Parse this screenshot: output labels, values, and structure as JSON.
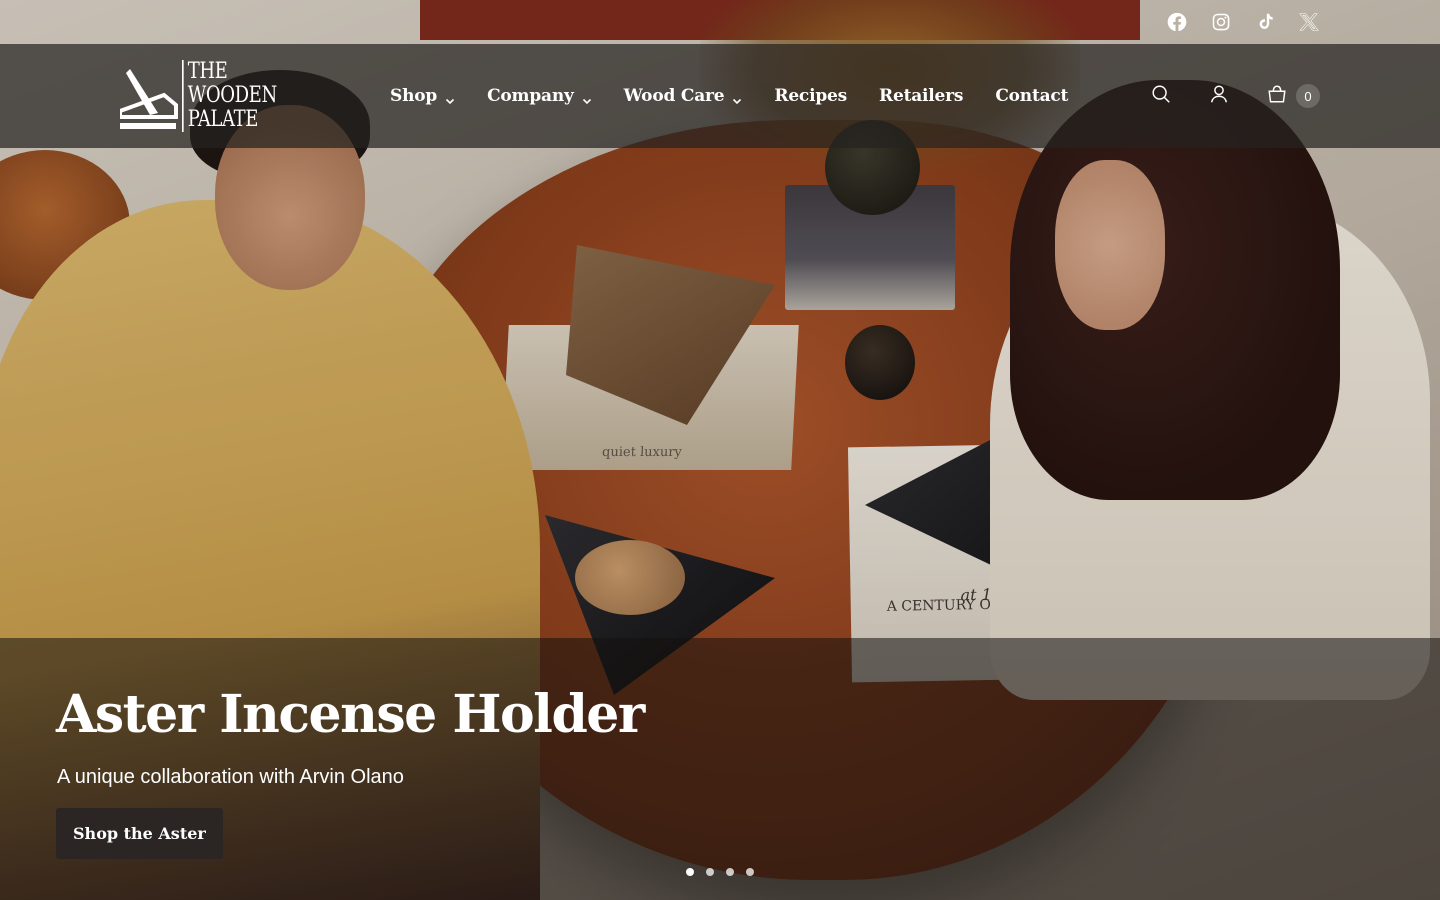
{
  "brand": {
    "logo_lines": [
      "THE",
      "WOODEN",
      "PALATE"
    ]
  },
  "social": [
    {
      "name": "facebook-icon"
    },
    {
      "name": "instagram-icon"
    },
    {
      "name": "tiktok-icon"
    },
    {
      "name": "x-icon"
    }
  ],
  "nav": {
    "items": [
      {
        "label": "Shop",
        "has_dropdown": true
      },
      {
        "label": "Company",
        "has_dropdown": true
      },
      {
        "label": "Wood Care",
        "has_dropdown": true
      },
      {
        "label": "Recipes",
        "has_dropdown": false
      },
      {
        "label": "Retailers",
        "has_dropdown": false
      },
      {
        "label": "Contact",
        "has_dropdown": false
      }
    ]
  },
  "header": {
    "cart_count": "0"
  },
  "hero": {
    "title": "Aster Incense Holder",
    "subtitle": "A unique collaboration with Arvin Olano",
    "cta_label": "Shop the Aster",
    "slides_total": 4,
    "active_slide": 1,
    "photo_text": {
      "book_spine": "quiet luxury",
      "book_cover_line1": "at 100",
      "book_cover_line2": "A CENTURY OF STYLE"
    }
  },
  "colors": {
    "header_bg": "#262220",
    "cta_bg": "#2b2624",
    "text": "#ffffff"
  }
}
